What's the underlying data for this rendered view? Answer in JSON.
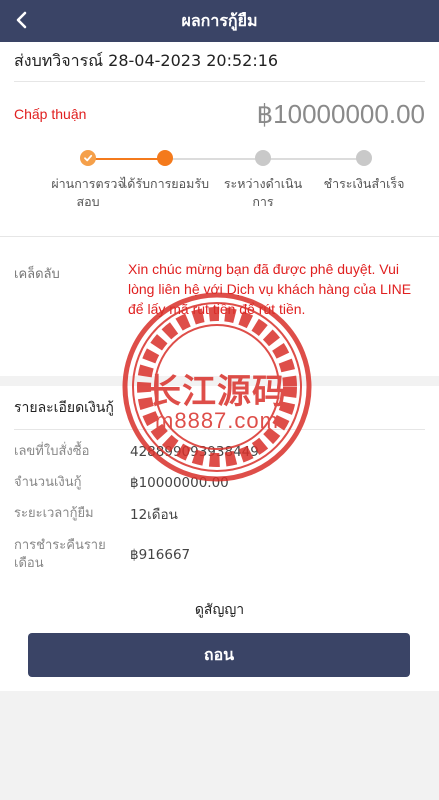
{
  "header": {
    "title": "ผลการกู้ยืม"
  },
  "submission": {
    "text": "ส่งบทวิจารณ์ 28-04-2023 20:52:16"
  },
  "status": {
    "label": "Chấp thuận",
    "amount": "฿10000000.00"
  },
  "steps": [
    {
      "label": "ผ่านการตรวจสอบ",
      "state": "done"
    },
    {
      "label": "ได้รับการยอมรับ",
      "state": "active"
    },
    {
      "label": "ระหว่างดำเนินการ",
      "state": "pending"
    },
    {
      "label": "ชำระเงินสำเร็จ",
      "state": "pending"
    }
  ],
  "tips": {
    "key": "เคล็ดลับ",
    "message": "Xin chúc mừng bạn đã được phê duyệt. Vui lòng liên hệ với Dịch vụ khách hàng của LINE để lấy mã rút tiền để rút tiền."
  },
  "details": {
    "title": "รายละเอียดเงินกู้",
    "rows": [
      {
        "key": "เลขที่ใบสั่งซื้อ",
        "value": "428899093938449"
      },
      {
        "key": "จำนวนเงินกู้",
        "value": "฿10000000.00"
      },
      {
        "key": "ระยะเวลากู้ยืม",
        "value": "12เดือน"
      },
      {
        "key": "การชำระคืนรายเดือน",
        "value": "฿916667"
      }
    ]
  },
  "contract": {
    "label": "ดูสัญญา"
  },
  "withdraw": {
    "label": "ถอน"
  },
  "watermark": {
    "line1": "长江源码",
    "line2": "m8887.com"
  },
  "colors": {
    "primary": "#3a4466",
    "accent": "#f47a1c",
    "alert": "#e02020",
    "stamp": "#d9302a"
  }
}
